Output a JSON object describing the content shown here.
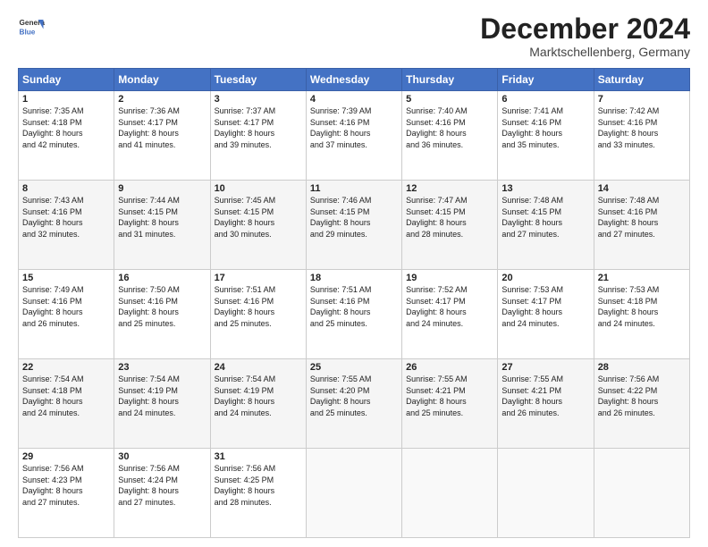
{
  "header": {
    "logo_line1": "General",
    "logo_line2": "Blue",
    "month": "December 2024",
    "location": "Marktschellenberg, Germany"
  },
  "weekdays": [
    "Sunday",
    "Monday",
    "Tuesday",
    "Wednesday",
    "Thursday",
    "Friday",
    "Saturday"
  ],
  "weeks": [
    [
      {
        "day": "1",
        "info": "Sunrise: 7:35 AM\nSunset: 4:18 PM\nDaylight: 8 hours\nand 42 minutes."
      },
      {
        "day": "2",
        "info": "Sunrise: 7:36 AM\nSunset: 4:17 PM\nDaylight: 8 hours\nand 41 minutes."
      },
      {
        "day": "3",
        "info": "Sunrise: 7:37 AM\nSunset: 4:17 PM\nDaylight: 8 hours\nand 39 minutes."
      },
      {
        "day": "4",
        "info": "Sunrise: 7:39 AM\nSunset: 4:16 PM\nDaylight: 8 hours\nand 37 minutes."
      },
      {
        "day": "5",
        "info": "Sunrise: 7:40 AM\nSunset: 4:16 PM\nDaylight: 8 hours\nand 36 minutes."
      },
      {
        "day": "6",
        "info": "Sunrise: 7:41 AM\nSunset: 4:16 PM\nDaylight: 8 hours\nand 35 minutes."
      },
      {
        "day": "7",
        "info": "Sunrise: 7:42 AM\nSunset: 4:16 PM\nDaylight: 8 hours\nand 33 minutes."
      }
    ],
    [
      {
        "day": "8",
        "info": "Sunrise: 7:43 AM\nSunset: 4:16 PM\nDaylight: 8 hours\nand 32 minutes."
      },
      {
        "day": "9",
        "info": "Sunrise: 7:44 AM\nSunset: 4:15 PM\nDaylight: 8 hours\nand 31 minutes."
      },
      {
        "day": "10",
        "info": "Sunrise: 7:45 AM\nSunset: 4:15 PM\nDaylight: 8 hours\nand 30 minutes."
      },
      {
        "day": "11",
        "info": "Sunrise: 7:46 AM\nSunset: 4:15 PM\nDaylight: 8 hours\nand 29 minutes."
      },
      {
        "day": "12",
        "info": "Sunrise: 7:47 AM\nSunset: 4:15 PM\nDaylight: 8 hours\nand 28 minutes."
      },
      {
        "day": "13",
        "info": "Sunrise: 7:48 AM\nSunset: 4:15 PM\nDaylight: 8 hours\nand 27 minutes."
      },
      {
        "day": "14",
        "info": "Sunrise: 7:48 AM\nSunset: 4:16 PM\nDaylight: 8 hours\nand 27 minutes."
      }
    ],
    [
      {
        "day": "15",
        "info": "Sunrise: 7:49 AM\nSunset: 4:16 PM\nDaylight: 8 hours\nand 26 minutes."
      },
      {
        "day": "16",
        "info": "Sunrise: 7:50 AM\nSunset: 4:16 PM\nDaylight: 8 hours\nand 25 minutes."
      },
      {
        "day": "17",
        "info": "Sunrise: 7:51 AM\nSunset: 4:16 PM\nDaylight: 8 hours\nand 25 minutes."
      },
      {
        "day": "18",
        "info": "Sunrise: 7:51 AM\nSunset: 4:16 PM\nDaylight: 8 hours\nand 25 minutes."
      },
      {
        "day": "19",
        "info": "Sunrise: 7:52 AM\nSunset: 4:17 PM\nDaylight: 8 hours\nand 24 minutes."
      },
      {
        "day": "20",
        "info": "Sunrise: 7:53 AM\nSunset: 4:17 PM\nDaylight: 8 hours\nand 24 minutes."
      },
      {
        "day": "21",
        "info": "Sunrise: 7:53 AM\nSunset: 4:18 PM\nDaylight: 8 hours\nand 24 minutes."
      }
    ],
    [
      {
        "day": "22",
        "info": "Sunrise: 7:54 AM\nSunset: 4:18 PM\nDaylight: 8 hours\nand 24 minutes."
      },
      {
        "day": "23",
        "info": "Sunrise: 7:54 AM\nSunset: 4:19 PM\nDaylight: 8 hours\nand 24 minutes."
      },
      {
        "day": "24",
        "info": "Sunrise: 7:54 AM\nSunset: 4:19 PM\nDaylight: 8 hours\nand 24 minutes."
      },
      {
        "day": "25",
        "info": "Sunrise: 7:55 AM\nSunset: 4:20 PM\nDaylight: 8 hours\nand 25 minutes."
      },
      {
        "day": "26",
        "info": "Sunrise: 7:55 AM\nSunset: 4:21 PM\nDaylight: 8 hours\nand 25 minutes."
      },
      {
        "day": "27",
        "info": "Sunrise: 7:55 AM\nSunset: 4:21 PM\nDaylight: 8 hours\nand 26 minutes."
      },
      {
        "day": "28",
        "info": "Sunrise: 7:56 AM\nSunset: 4:22 PM\nDaylight: 8 hours\nand 26 minutes."
      }
    ],
    [
      {
        "day": "29",
        "info": "Sunrise: 7:56 AM\nSunset: 4:23 PM\nDaylight: 8 hours\nand 27 minutes."
      },
      {
        "day": "30",
        "info": "Sunrise: 7:56 AM\nSunset: 4:24 PM\nDaylight: 8 hours\nand 27 minutes."
      },
      {
        "day": "31",
        "info": "Sunrise: 7:56 AM\nSunset: 4:25 PM\nDaylight: 8 hours\nand 28 minutes."
      },
      {
        "day": "",
        "info": ""
      },
      {
        "day": "",
        "info": ""
      },
      {
        "day": "",
        "info": ""
      },
      {
        "day": "",
        "info": ""
      }
    ]
  ]
}
